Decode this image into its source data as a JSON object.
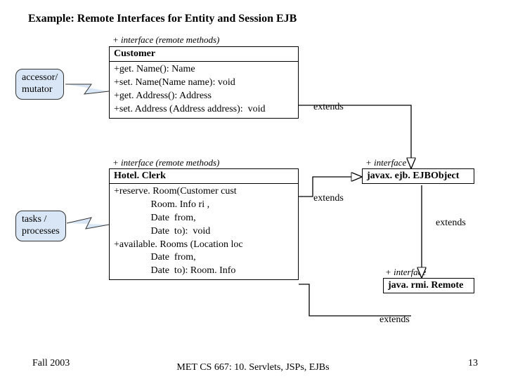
{
  "title": "Example: Remote Interfaces for Entity and Session EJB",
  "stereo": {
    "customer": "+ interface (remote methods)",
    "hotelclerk": "+ interface (remote methods)",
    "ejbobject": "+ interface",
    "remote": "+ interface"
  },
  "customer": {
    "name": "Customer",
    "ops": "+get. Name(): Name\n+set. Name(Name name): void\n+get. Address(): Address\n+set. Address (Address address):  void"
  },
  "hotelclerk": {
    "name": "Hotel. Clerk",
    "ops": "+reserve. Room(Customer cust\n               Room. Info ri ,\n               Date  from,\n               Date  to):  void\n+available. Rooms (Location loc\n               Date  from,\n               Date  to): Room. Info"
  },
  "ejbobject": {
    "name": "javax. ejb. EJBObject"
  },
  "remote": {
    "name": "java. rmi. Remote"
  },
  "callout": {
    "accessor": "accessor/\nmutator",
    "tasks": "tasks /\nprocesses"
  },
  "ext": {
    "e1": "extends",
    "e2": "extends",
    "e3": "extends",
    "e4": "extends"
  },
  "footer": {
    "left": "Fall 2003",
    "mid": "MET CS 667: 10. Servlets, JSPs, EJBs",
    "right": "13"
  }
}
